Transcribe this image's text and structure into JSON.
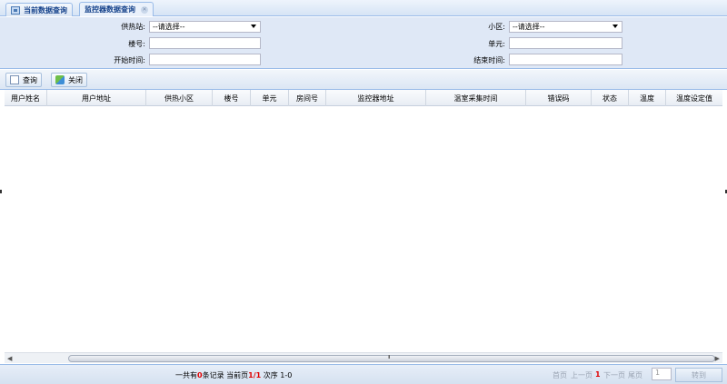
{
  "tabs": [
    {
      "label": "当前数据查询"
    },
    {
      "label": "监控器数据查询"
    }
  ],
  "search": {
    "supply_station_label": "供热站:",
    "supply_station_value": "--请选择--",
    "community_label": "小区:",
    "community_value": "--请选择--",
    "building_label": "楼号:",
    "unit_label": "单元:",
    "start_time_label": "开始时间:",
    "end_time_label": "结束时间:"
  },
  "toolbar": {
    "query_label": "查询",
    "close_label": "关闭"
  },
  "table": {
    "columns": [
      "用户姓名",
      "用户地址",
      "供热小区",
      "楼号",
      "单元",
      "房间号",
      "监控器地址",
      "温室采集时间",
      "错误码",
      "状态",
      "温度",
      "温度设定值"
    ]
  },
  "scrollbar": {
    "grip": "III"
  },
  "pager": {
    "total_prefix": "一共有",
    "total_count": "0",
    "total_suffix": "条记录  当前页",
    "current_page": "1/1",
    "order_label": " 次序 1-0",
    "first": "首页",
    "prev": "上一页",
    "page_num": "1",
    "next": "下一页",
    "last": "尾页",
    "jump_value": "1",
    "go_label": "转到"
  }
}
